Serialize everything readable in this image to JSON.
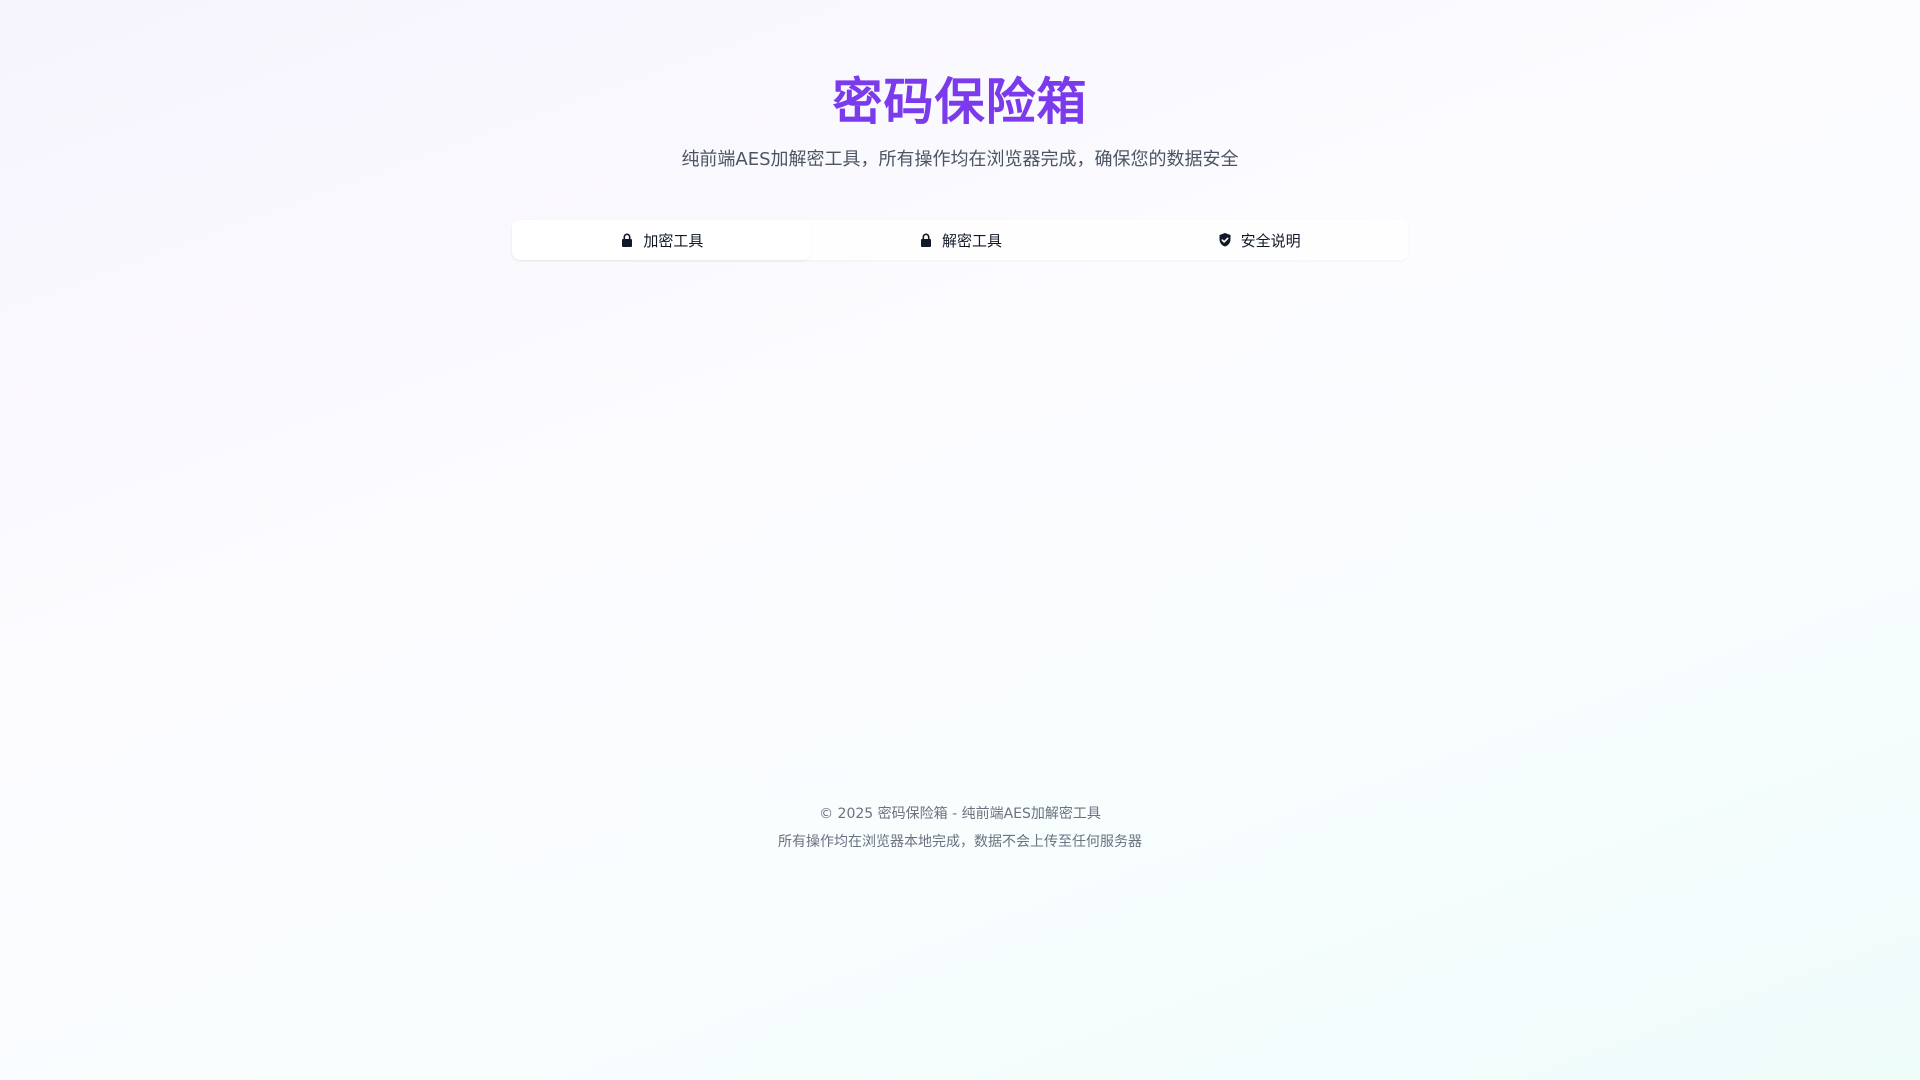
{
  "header": {
    "title": "密码保险箱",
    "subtitle": "纯前端AES加解密工具，所有操作均在浏览器完成，确保您的数据安全"
  },
  "tabs": [
    {
      "label": "加密工具",
      "icon": "lock-icon",
      "active": true
    },
    {
      "label": "解密工具",
      "icon": "lock-icon",
      "active": false
    },
    {
      "label": "安全说明",
      "icon": "shield-check-icon",
      "active": false
    }
  ],
  "footer": {
    "line1": "© 2025 密码保险箱 - 纯前端AES加解密工具",
    "line2": "所有操作均在浏览器本地完成，数据不会上传至任何服务器"
  },
  "colors": {
    "accent": "#7c3aed",
    "text": "#111827",
    "muted": "#6b7280"
  }
}
